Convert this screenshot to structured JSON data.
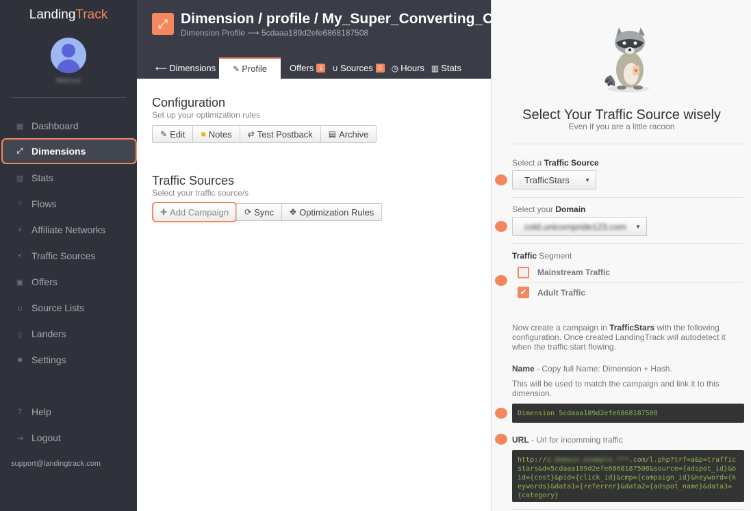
{
  "brand": {
    "name_left": "Landing",
    "name_right": "Track"
  },
  "user": {
    "name": "Marcos"
  },
  "sidebar": {
    "items": [
      {
        "label": "Dashboard",
        "icon": "dashboard-icon"
      },
      {
        "label": "Dimensions",
        "icon": "expand-icon",
        "active": true
      },
      {
        "label": "Stats",
        "icon": "bar-chart-icon"
      },
      {
        "label": "Flows",
        "icon": "flow-icon"
      },
      {
        "label": "Affiliate Networks",
        "icon": "plug-icon"
      },
      {
        "label": "Traffic Sources",
        "icon": "plug-icon"
      },
      {
        "label": "Offers",
        "icon": "image-icon"
      },
      {
        "label": "Source Lists",
        "icon": "magnet-icon"
      },
      {
        "label": "Landers",
        "icon": "file-icon"
      },
      {
        "label": "Settings",
        "icon": "gear-icon"
      }
    ],
    "help": "Help",
    "logout": "Logout",
    "support": "support@landingtrack.com"
  },
  "header": {
    "title": "Dimension / profile / My_Super_Converting_Offer",
    "subtitle": "Dimension Profile ⟶ 5cdaaa189d2efe6868187508",
    "tabs": [
      {
        "label": "Dimensions",
        "icon": "arrow-left-icon"
      },
      {
        "label": "Profile",
        "icon": "pencil-icon",
        "active": true
      },
      {
        "label": "Offers",
        "badge": "1"
      },
      {
        "label": "Sources",
        "icon": "magnet-icon",
        "badge": "0"
      },
      {
        "label": "Hours",
        "icon": "clock-icon"
      },
      {
        "label": "Stats",
        "icon": "bar-chart-icon"
      }
    ]
  },
  "configuration": {
    "title": "Configuration",
    "subtitle": "Set up your optimization rules",
    "buttons": [
      "Edit",
      "Notes",
      "Test Postback",
      "Archive"
    ]
  },
  "traffic_sources": {
    "title": "Traffic Sources",
    "subtitle": "Select your traffic source/s",
    "buttons": [
      "Add Campaign",
      "Sync",
      "Optimization Rules"
    ]
  },
  "panel": {
    "title": "Select Your Traffic Source wisely",
    "subtitle": "Even if you are a little racoon",
    "source_label_pre": "Select a ",
    "source_label_bold": "Traffic Source",
    "source_value": "TrafficStars",
    "domain_label_pre": "Select your ",
    "domain_label_bold": "Domain",
    "domain_value": "cold.unicornpride123.com",
    "segment_label_bold": "Traffic",
    "segment_label_post": " Segment",
    "segments": [
      {
        "label": "Mainstream Traffic",
        "checked": false
      },
      {
        "label": "Adult Traffic",
        "checked": true
      }
    ],
    "instructions_pre": "Now create a campaign in ",
    "instructions_bold": "TrafficStars",
    "instructions_post": " with the following configuration. Once created LandingTrack will autodetect it when the traffic start flowing.",
    "name_bold": "Name",
    "name_desc": " - Copy full Name: Dimension + Hash.",
    "name_note": "This will be used to match the campaign and link it to this dimension.",
    "name_code": "Dimension 5cdaaa189d2efe6868187508",
    "url_bold": "URL",
    "url_desc": " - Url for incomming traffic",
    "url_code_prefix": "http://",
    "url_code_blur": "a.domain.example.***",
    "url_code_rest": ".com/l.php?trf=a&p=trafficstars&d=5cdaaa189d2efe6868187508&source={adspot_id}&bid={cost}&pid={click_id}&cmp={campaign_id}&keyword={keywords}&data1={referrer}&data2={adspot_name}&data3={category}"
  },
  "colors": {
    "accent": "#f5875f",
    "sidebar": "#2f323a",
    "header": "#3a3d47",
    "code_bg": "#333333",
    "code_text": "#8fb84f"
  }
}
